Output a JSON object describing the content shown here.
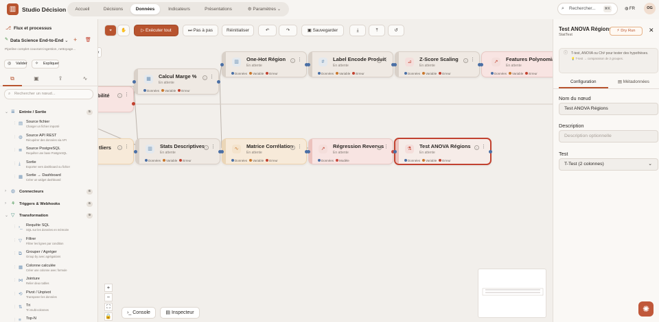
{
  "app": {
    "title": "Studio Décision",
    "logo": "brand-logo-icon"
  },
  "nav": {
    "items": [
      {
        "label": "Accueil"
      },
      {
        "label": "Décisions"
      },
      {
        "label": "Données"
      },
      {
        "label": "Indicateurs"
      },
      {
        "label": "Présentations"
      },
      {
        "label": "Paramètres"
      }
    ]
  },
  "search": {
    "placeholder": "Rechercher...",
    "shortcut": "⌘K"
  },
  "header": {
    "lang": "FR",
    "user_initials": "OG"
  },
  "sidebar": {
    "title": "Flux et processus",
    "pipeline": "Data Science End-to-End",
    "pipeline_desc": "Pipeline complet couvrant ingestion, nettoyage...",
    "validate": "Valider",
    "explain": "Expliquer",
    "search_placeholder": "Rechercher un nœud...",
    "categories": [
      {
        "label": "Entrée / Sortie",
        "count": "5"
      },
      {
        "label": "Connecteurs",
        "count": "6"
      },
      {
        "label": "Triggers & Webhooks",
        "count": "6"
      },
      {
        "label": "Transformation",
        "count": "9"
      }
    ],
    "io_items": [
      {
        "label": "Source fichier",
        "desc": "Charger un fichier importé"
      },
      {
        "label": "Source API REST",
        "desc": "Récupérer des données via API"
      },
      {
        "label": "Source PostgreSQL",
        "desc": "Requêter une base PostgreSQL"
      },
      {
        "label": "Sortie",
        "desc": "Exporter vers dashboard ou fichier"
      },
      {
        "label": "Sortie → Dashboard",
        "desc": "Créer un widget dashboard"
      }
    ],
    "transform_items": [
      {
        "label": "Requête SQL",
        "desc": "SQL sur les données en mémoire"
      },
      {
        "label": "Filtrer",
        "desc": "Filtrer les lignes par condition"
      },
      {
        "label": "Grouper / Agréger",
        "desc": "Group by avec agrégations"
      },
      {
        "label": "Colonne calculée",
        "desc": "Créer une colonne avec formule"
      },
      {
        "label": "Jointure",
        "desc": "Relier deux tables"
      },
      {
        "label": "Pivot / Unpivot",
        "desc": "Transposer les données"
      },
      {
        "label": "Tri",
        "desc": "Tri multi-colonnes"
      },
      {
        "label": "Top-N",
        "desc": ""
      }
    ]
  },
  "toolbar": {
    "run": "Exécuter tout",
    "step": "Pas à pas",
    "reset": "Réinitialiser",
    "save": "Sauvegarder"
  },
  "nodes": [
    {
      "title": "Calcul Marge %",
      "status": "En attente",
      "ports": [
        "Données",
        "Variable",
        "Erreur"
      ]
    },
    {
      "title": "One-Hot Région",
      "status": "En attente",
      "ports": [
        "Données",
        "Variable",
        "Erreur"
      ]
    },
    {
      "title": "Label Encode Produit",
      "status": "En attente",
      "ports": [
        "Données",
        "Variable",
        "Erreur"
      ]
    },
    {
      "title": "Z-Score Scaling",
      "status": "En attente",
      "ports": [
        "Données",
        "Variable",
        "Erreur"
      ]
    },
    {
      "title": "Features Polynomial",
      "status": "En attente",
      "ports": [
        "Données",
        "Variable",
        "Erreur"
      ]
    },
    {
      "title": "Stats Descriptives",
      "status": "En attente",
      "ports": [
        "Données",
        "Variable",
        "Erreur"
      ]
    },
    {
      "title": "Matrice Corrélation",
      "status": "En attente",
      "ports": [
        "Données",
        "Variable",
        "Erreur"
      ]
    },
    {
      "title": "Régression Revenus",
      "status": "En attente",
      "ports": [
        "Données",
        "Modèle"
      ]
    },
    {
      "title": "Test ANOVA Régions",
      "status": "En attente",
      "ports": [
        "Données",
        "Variable",
        "Erreur"
      ]
    },
    {
      "title": "bilité",
      "status": "",
      "ports": []
    },
    {
      "title": "tliers",
      "status": "",
      "ports": []
    }
  ],
  "bottom": {
    "console": "Console",
    "inspector": "Inspecteur"
  },
  "panel": {
    "title": "Test ANOVA Régions",
    "subtitle": "StatTest",
    "dry_run": "Dry Run",
    "hint": "T-test, ANOVA ou Chi² pour tester des hypothèses.",
    "hint_sub": "T-test → comparaison de 2 groupes.",
    "tab_config": "Configuration",
    "tab_meta": "Métadonnées",
    "name_label": "Nom du nœud",
    "name_value": "Test ANOVA Régions",
    "desc_label": "Description",
    "desc_placeholder": "Description optionnelle",
    "test_label": "Test",
    "test_value": "T-Test (2 colonnes)"
  },
  "colors": {
    "accent": "#b8542f",
    "port_data": "#4a6fa5",
    "port_variable": "#c9772b",
    "port_error": "#c2412f",
    "port_model": "#c94a3f"
  }
}
